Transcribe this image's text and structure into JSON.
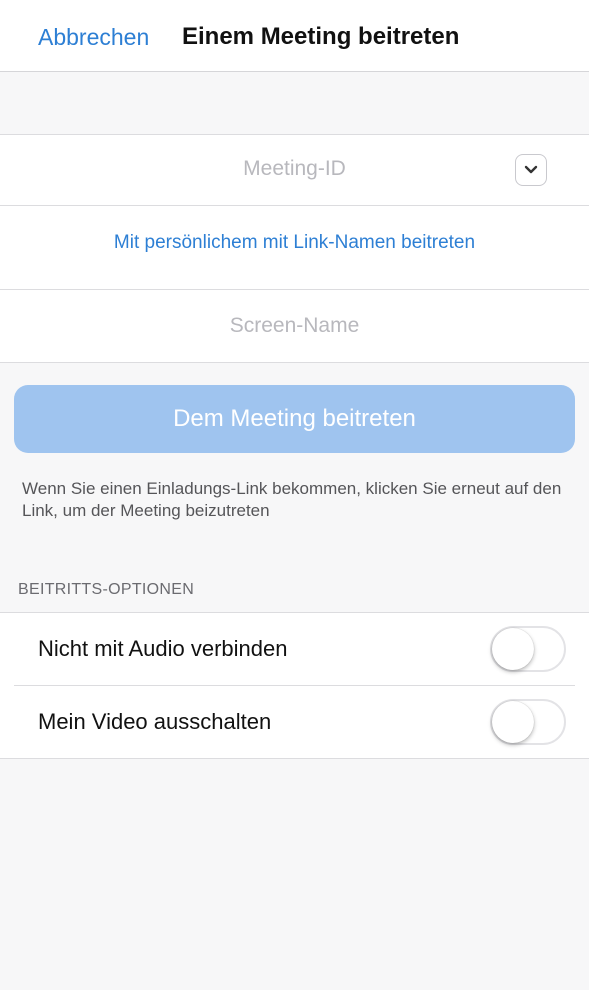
{
  "nav": {
    "cancel_label": "Abbrechen",
    "title": "Einem Meeting beitreten"
  },
  "meeting_id": {
    "placeholder": "Meeting-ID",
    "dropdown_icon": "chevron-down-icon"
  },
  "link_join_label": "Mit persönlichem mit Link-Namen beitreten",
  "screen_name": {
    "placeholder": "Screen-Name"
  },
  "join_button_label": "Dem Meeting beitreten",
  "hint_text": "Wenn Sie einen Einladungs-Link bekommen, klicken Sie erneut auf den Link, um der Meeting beizutreten",
  "options": {
    "header": "BEITRITTS-OPTIONEN",
    "items": [
      {
        "label": "Nicht mit Audio verbinden",
        "enabled": false
      },
      {
        "label": "Mein Video ausschalten",
        "enabled": false
      }
    ]
  },
  "colors": {
    "accent": "#2d7fd4",
    "join_button_disabled": "#9fc4ef",
    "background": "#f7f7f8"
  }
}
